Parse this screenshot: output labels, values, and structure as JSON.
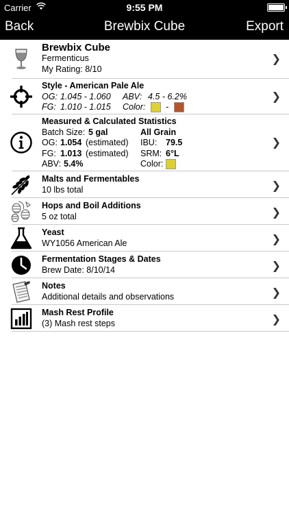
{
  "status": {
    "carrier": "Carrier",
    "time": "9:55 PM"
  },
  "nav": {
    "back": "Back",
    "title": "Brewbix Cube",
    "export": "Export"
  },
  "recipe": {
    "name": "Brewbix Cube",
    "brewer": "Fermenticus",
    "rating": "My Rating:  8/10"
  },
  "style": {
    "title": "Style - American Pale Ale",
    "og_label": "OG:",
    "og": "1.045 - 1.060",
    "abv_label": "ABV:",
    "abv": "4.5 - 6.2%",
    "fg_label": "FG:",
    "fg": "1.010 - 1.015",
    "color_label": "Color:",
    "dash": "-",
    "color_low": "#ddd033",
    "color_high": "#b5552e"
  },
  "stats": {
    "title": "Measured & Calculated Statistics",
    "batch_label": "Batch Size:",
    "batch": "5 gal",
    "method": "All Grain",
    "og_label": "OG:",
    "og": "1.054",
    "og_note": "(estimated)",
    "ibu_label": "IBU:",
    "ibu": "79.5",
    "fg_label": "FG:",
    "fg": "1.013",
    "fg_note": "(estimated)",
    "srm_label": "SRM:",
    "srm": "6°L",
    "abv_label": "ABV:",
    "abv": "5.4%",
    "color_label": "Color:",
    "color": "#ddd033"
  },
  "malts": {
    "title": "Malts and Fermentables",
    "detail": "10 lbs total"
  },
  "hops": {
    "title": "Hops and Boil Additions",
    "detail": "5 oz total"
  },
  "yeast": {
    "title": "Yeast",
    "detail": "WY1056 American Ale"
  },
  "fermentation": {
    "title": "Fermentation Stages & Dates",
    "detail": "Brew Date: 8/10/14"
  },
  "notes": {
    "title": "Notes",
    "detail": "Additional details and observations"
  },
  "mash": {
    "title": "Mash Rest Profile",
    "detail": "(3) Mash rest steps"
  },
  "chevron": "❯",
  "icons": [
    "glass-icon",
    "target-icon",
    "info-icon",
    "wheat-icon",
    "hops-icon",
    "flask-icon",
    "clock-icon",
    "notepad-icon",
    "bar-chart-icon"
  ]
}
